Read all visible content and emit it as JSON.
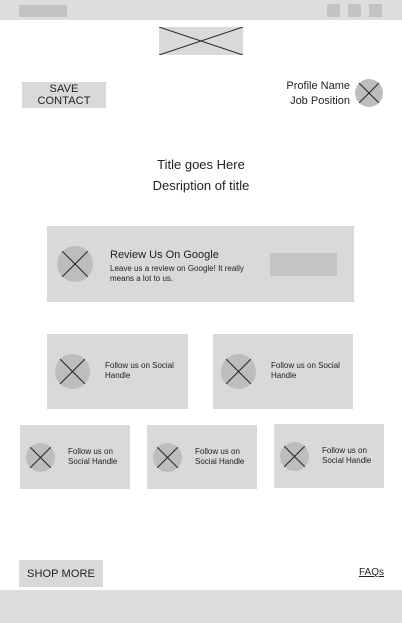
{
  "header": {
    "save_contact_label": "SAVE CONTACT",
    "profile_name": "Profile Name",
    "job_position": "Job Position"
  },
  "hero": {
    "title": "Title goes Here",
    "description": "Desription of title"
  },
  "review_card": {
    "title": "Review Us On Google",
    "description": "Leave us a review on Google! It really means a lot to us."
  },
  "social_cards": [
    {
      "label": "Follow us on Social Handle"
    },
    {
      "label": "Follow us on Social Handle"
    },
    {
      "label": "Follow us on Social Handle"
    },
    {
      "label": "Follow us on Social Handle"
    },
    {
      "label": "Follow us on Social Handle"
    }
  ],
  "footer": {
    "shop_more_label": "SHOP MORE",
    "faqs_label": "FAQs"
  },
  "colors": {
    "placeholder": "#d9d9d9",
    "avatar": "#bdbdbd",
    "bar": "#dddddd",
    "text": "#1f1f1f"
  }
}
